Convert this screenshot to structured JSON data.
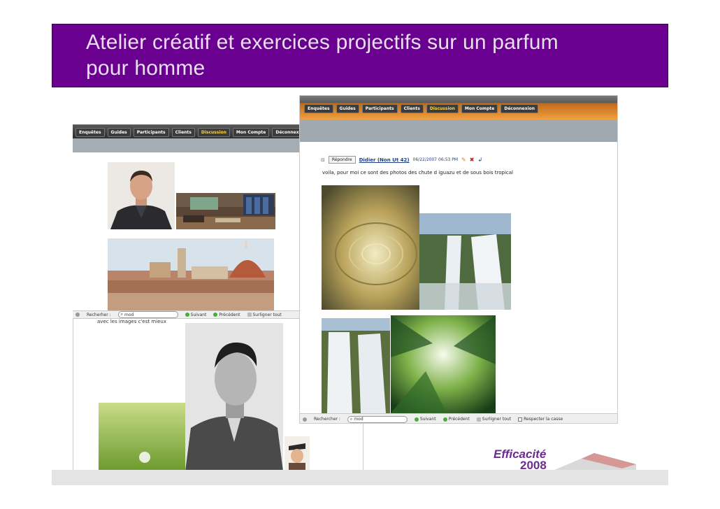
{
  "slide": {
    "title_line1": "Atelier créatif et exercices projectifs sur un parfum",
    "title_line2": "pour homme",
    "colors": {
      "title_bg": "#6a008f",
      "title_text": "#e8e0ef",
      "logo": "#6a2c8f"
    }
  },
  "nav_tabs": [
    "Enquêtes",
    "Guides",
    "Participants",
    "Clients",
    "Discussion",
    "Mon Compte",
    "Déconnexion"
  ],
  "active_tab": "Discussion",
  "left_window": {
    "caption_text": "avec les images c'est mieux",
    "toolbar": {
      "label": "Recherher :",
      "search_value": "mod",
      "next": "Suivant",
      "prev": "Précédent",
      "highlight": "Surligner tout"
    }
  },
  "right_window": {
    "post": {
      "reply_label": "Répondre",
      "user": "Didier (Non Ut 42)",
      "datetime": "06/22/2007 06:53 PM",
      "text": "voila, pour moi ce sont des photos des chute d iguazu et de sous bois tropical"
    },
    "toolbar": {
      "label": "Rechercher :",
      "search_value": "mod",
      "next": "Suivant",
      "prev": "Précédent",
      "highlight": "Surligner tout",
      "match_case": "Respecter la casse"
    }
  },
  "logo": {
    "brand": "Efficacité",
    "year": "2008"
  },
  "icons": [
    "search-icon",
    "next-arrow-icon",
    "prev-arrow-icon",
    "highlight-icon",
    "close-icon",
    "edit-icon",
    "delete-icon",
    "reply-icon"
  ]
}
